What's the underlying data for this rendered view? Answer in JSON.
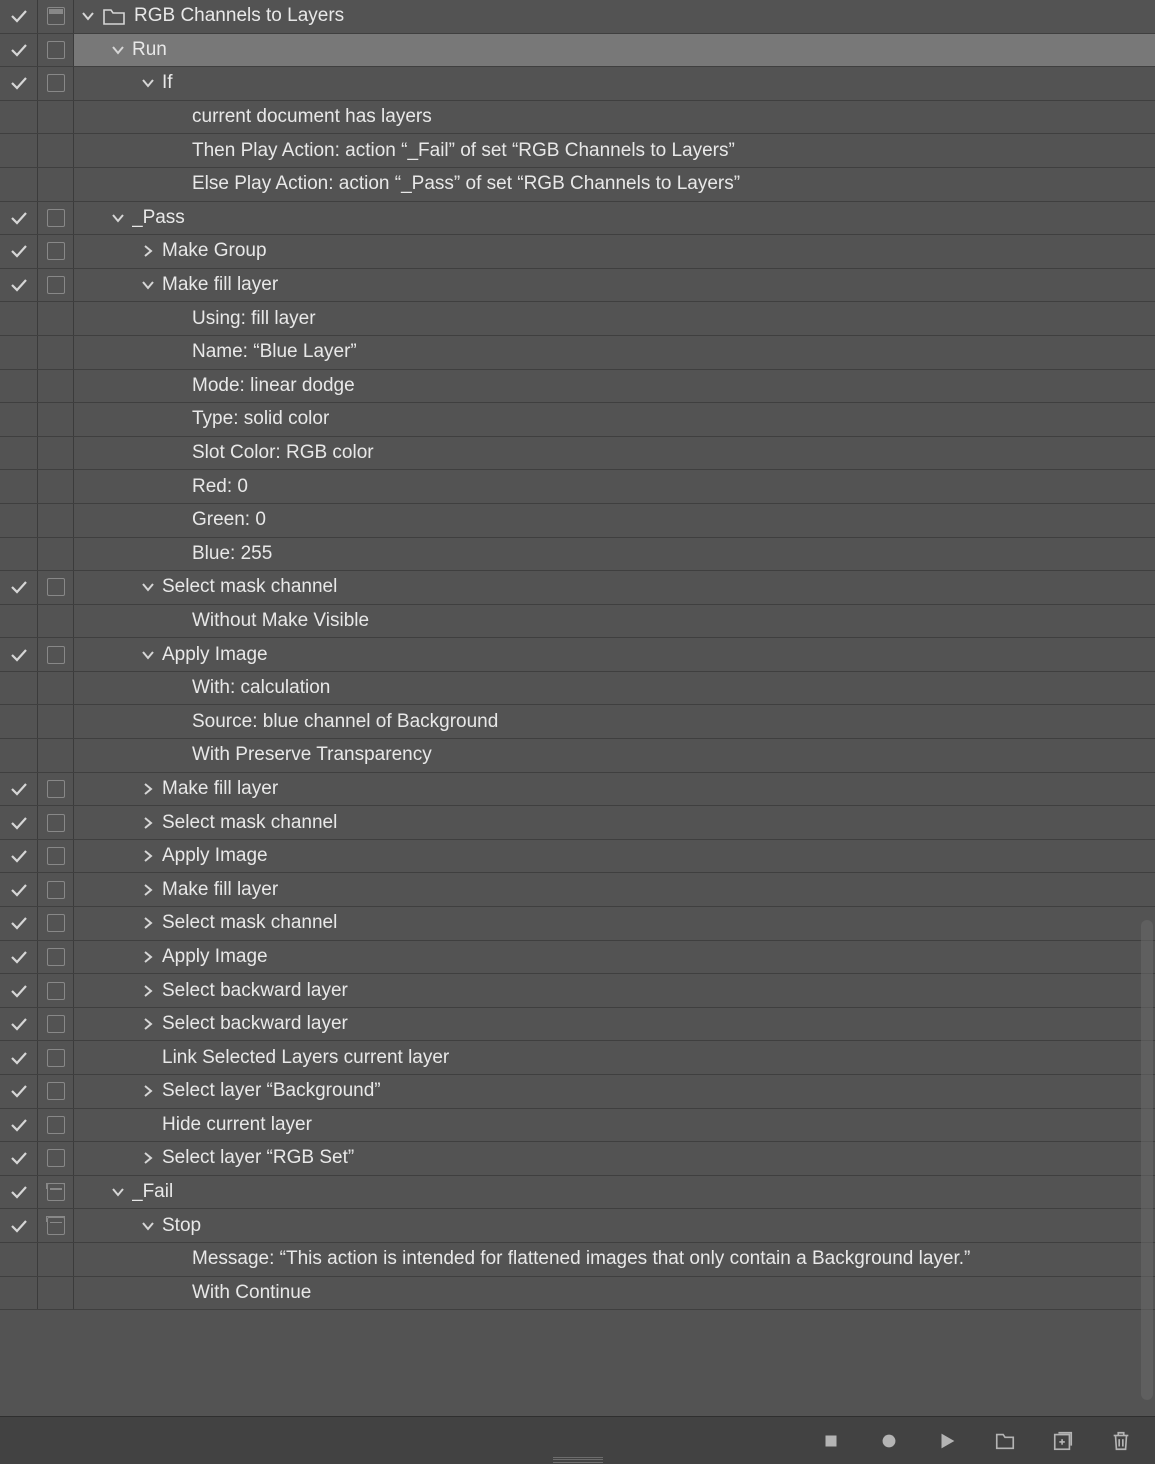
{
  "set": {
    "name": "RGB Channels to Layers",
    "expanded": true,
    "checked": true,
    "dialogState": "some"
  },
  "actions": [
    {
      "type": "action",
      "name": "Run",
      "indent": 1,
      "checked": true,
      "dialog": "empty",
      "expanded": true,
      "selected": true
    },
    {
      "type": "step",
      "name": "If",
      "indent": 2,
      "checked": true,
      "dialog": "empty",
      "expanded": true,
      "details": [
        "current document has layers",
        "Then Play Action: action “_Fail” of set “RGB Channels to Layers”",
        "Else Play Action: action “_Pass” of set “RGB Channels to Layers”"
      ]
    },
    {
      "type": "action",
      "name": "_Pass",
      "indent": 1,
      "checked": true,
      "dialog": "empty",
      "expanded": true
    },
    {
      "type": "step",
      "name": "Make Group",
      "indent": 2,
      "checked": true,
      "dialog": "empty",
      "expanded": false
    },
    {
      "type": "step",
      "name": "Make fill layer",
      "indent": 2,
      "checked": true,
      "dialog": "empty",
      "expanded": true,
      "details": [
        "Using: fill layer",
        "Name:  “Blue Layer”",
        "Mode: linear dodge",
        "Type: solid color",
        "Slot Color: RGB color",
        "Red: 0",
        "Green: 0",
        "Blue: 255"
      ]
    },
    {
      "type": "step",
      "name": "Select mask channel",
      "indent": 2,
      "checked": true,
      "dialog": "empty",
      "expanded": true,
      "details": [
        "Without Make Visible"
      ]
    },
    {
      "type": "step",
      "name": "Apply Image",
      "indent": 2,
      "checked": true,
      "dialog": "empty",
      "expanded": true,
      "details": [
        "With: calculation",
        "Source: blue channel of Background",
        "With Preserve Transparency"
      ]
    },
    {
      "type": "step",
      "name": "Make fill layer",
      "indent": 2,
      "checked": true,
      "dialog": "empty",
      "expanded": false
    },
    {
      "type": "step",
      "name": "Select mask channel",
      "indent": 2,
      "checked": true,
      "dialog": "empty",
      "expanded": false
    },
    {
      "type": "step",
      "name": "Apply Image",
      "indent": 2,
      "checked": true,
      "dialog": "empty",
      "expanded": false
    },
    {
      "type": "step",
      "name": "Make fill layer",
      "indent": 2,
      "checked": true,
      "dialog": "empty",
      "expanded": false
    },
    {
      "type": "step",
      "name": "Select mask channel",
      "indent": 2,
      "checked": true,
      "dialog": "empty",
      "expanded": false
    },
    {
      "type": "step",
      "name": "Apply Image",
      "indent": 2,
      "checked": true,
      "dialog": "empty",
      "expanded": false
    },
    {
      "type": "step",
      "name": "Select backward layer",
      "indent": 2,
      "checked": true,
      "dialog": "empty",
      "expanded": false
    },
    {
      "type": "step",
      "name": "Select backward layer",
      "indent": 2,
      "checked": true,
      "dialog": "empty",
      "expanded": false
    },
    {
      "type": "step",
      "name": "Link Selected Layers current layer",
      "indent": 2,
      "checked": true,
      "dialog": "empty",
      "noToggle": true
    },
    {
      "type": "step",
      "name": "Select layer “Background”",
      "indent": 2,
      "checked": true,
      "dialog": "empty",
      "expanded": false
    },
    {
      "type": "step",
      "name": "Hide current layer",
      "indent": 2,
      "checked": true,
      "dialog": "empty",
      "noToggle": true
    },
    {
      "type": "step",
      "name": "Select layer “RGB Set”",
      "indent": 2,
      "checked": true,
      "dialog": "empty",
      "expanded": false
    },
    {
      "type": "action",
      "name": "_Fail",
      "indent": 1,
      "checked": true,
      "dialog": "dialog",
      "expanded": true
    },
    {
      "type": "step",
      "name": "Stop",
      "indent": 2,
      "checked": true,
      "dialog": "dialog",
      "expanded": true,
      "details": [
        "Message:  “This action is intended for flattened images that only contain a Background layer.”",
        "With Continue"
      ]
    }
  ],
  "footer": {
    "stop": "stop",
    "record": "record",
    "play": "play",
    "newSet": "new-folder",
    "newAction": "new-item",
    "delete": "trash"
  }
}
